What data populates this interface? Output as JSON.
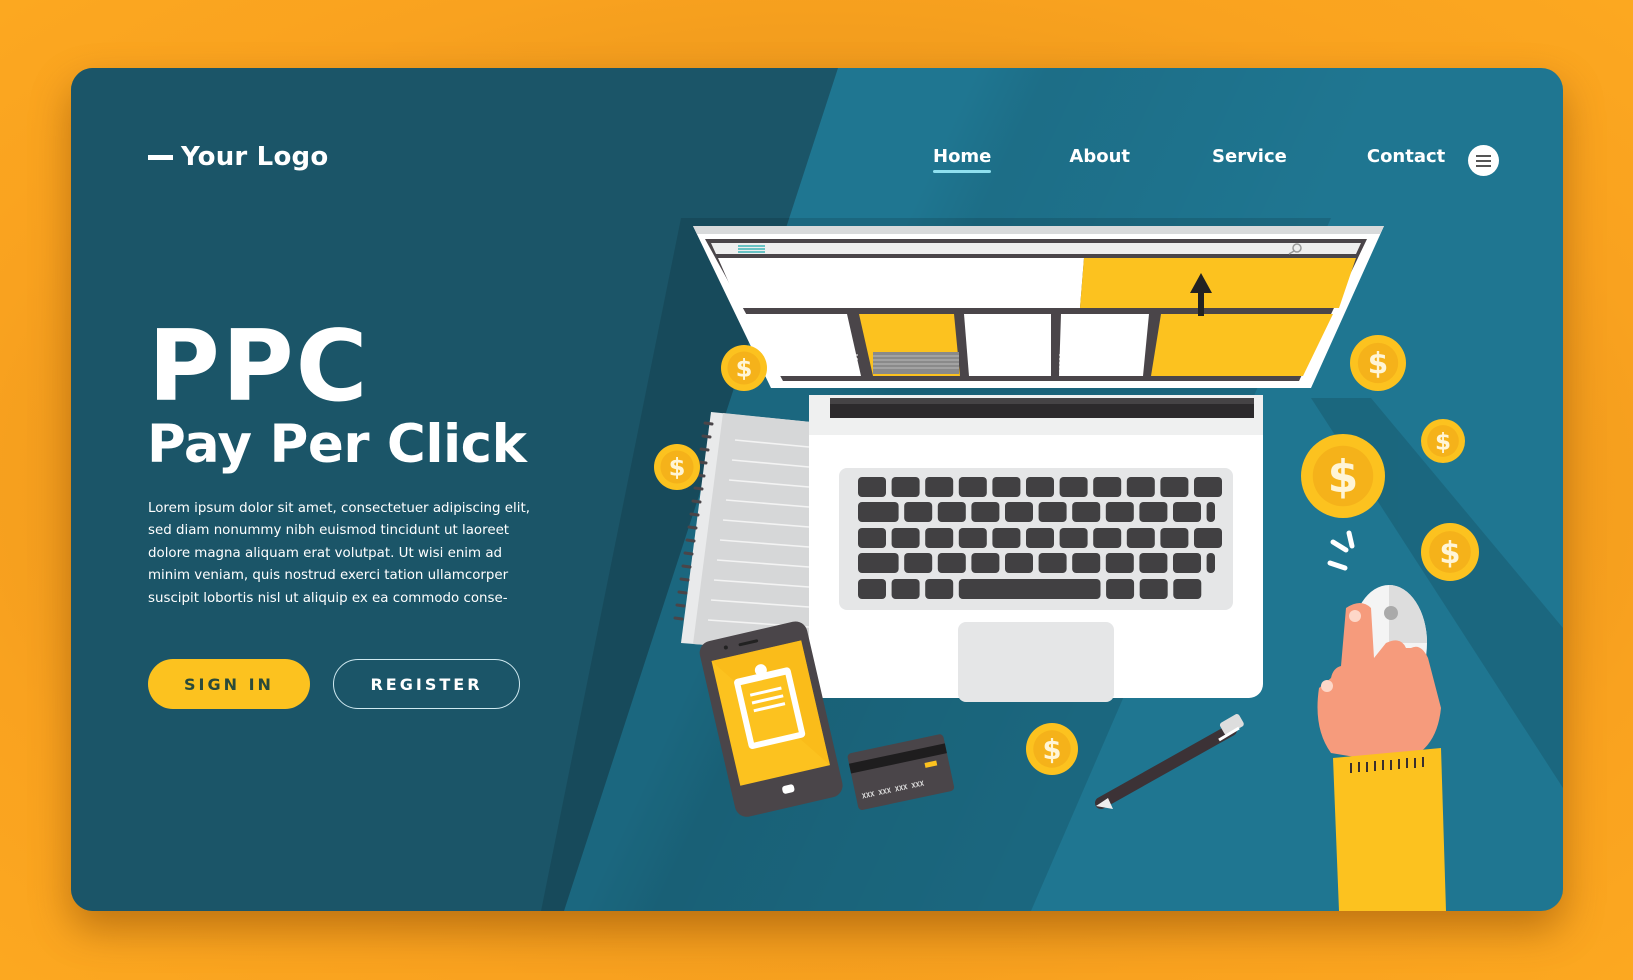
{
  "page": {
    "theme": {
      "background": "#f9a21f",
      "card_dark": "#1b5568",
      "card_light": "#1f7691",
      "accent_yellow": "#fcc21f",
      "text": "#ffffff"
    }
  },
  "header": {
    "logo_text": "Your Logo",
    "nav": [
      {
        "label": "Home",
        "active": true
      },
      {
        "label": "About",
        "active": false
      },
      {
        "label": "Service",
        "active": false
      },
      {
        "label": "Contact",
        "active": false
      }
    ],
    "menu_icon": "hamburger-menu-icon"
  },
  "hero": {
    "title": "PPC",
    "subtitle": "Pay Per Click",
    "body": "Lorem ipsum dolor sit amet, consectetuer adipiscing elit, sed diam nonummy nibh euismod tincidunt ut laoreet dolore magna aliquam erat volutpat. Ut wisi enim ad minim veniam, quis nostrud exerci tation ullamcorper suscipit lobortis nisl ut aliquip ex ea commodo conse-",
    "buttons": {
      "sign_in": "SIGN IN",
      "register": "REGISTER"
    }
  },
  "illustration": {
    "coin_symbol": "$",
    "card_number": "XXX  XXX  XXX  XXX",
    "icons": [
      "laptop-icon",
      "notebook-icon",
      "smartphone-icon",
      "clipboard-icon",
      "credit-card-icon",
      "pen-icon",
      "mouse-icon",
      "hand-icon",
      "coin-icon",
      "cursor-arrow-icon",
      "search-icon"
    ]
  }
}
